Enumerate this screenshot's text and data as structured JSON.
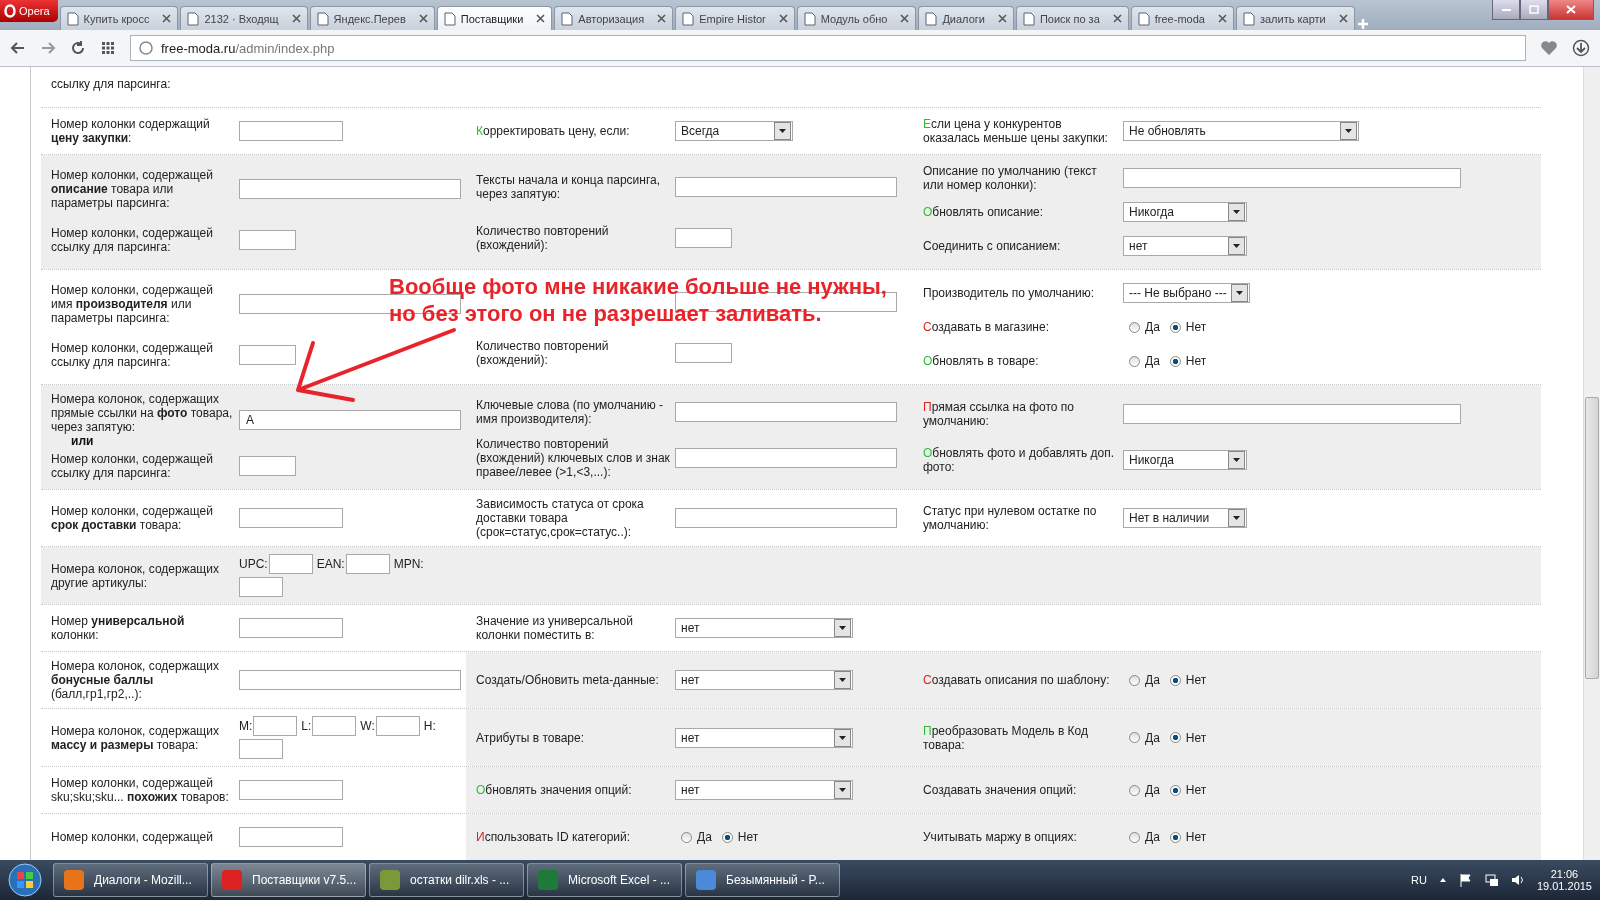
{
  "browser": {
    "menu_button": "Opera",
    "tabs": [
      {
        "label": "Купить кросс",
        "selected": false
      },
      {
        "label": "2132 · Входящ",
        "selected": false
      },
      {
        "label": "Яндекс.Перев",
        "selected": false
      },
      {
        "label": "Поставщики",
        "selected": true
      },
      {
        "label": "Авторизация",
        "selected": false
      },
      {
        "label": "Empire Histor",
        "selected": false
      },
      {
        "label": "Модуль обно",
        "selected": false
      },
      {
        "label": "Диалоги",
        "selected": false
      },
      {
        "label": "Поиск по за",
        "selected": false
      },
      {
        "label": "free-moda",
        "selected": false
      },
      {
        "label": "залить карти",
        "selected": false
      }
    ],
    "address": {
      "host": "free-moda.ru",
      "path": "/admin/index.php"
    }
  },
  "sections": [
    {
      "left_shaded": false,
      "right_shaded": false,
      "left": [
        {
          "label": "ссылку для парсинга:"
        }
      ]
    },
    {
      "left_shaded": false,
      "right_shaded": false,
      "left": [
        {
          "label": "Номер колонки содержащий **цену закупки**:",
          "control": {
            "kind": "input_medium"
          }
        }
      ],
      "middle": [
        {
          "label": "Корректировать цену, если:",
          "color": "#33bb33",
          "control": {
            "kind": "select_small",
            "value": "Всегда"
          }
        }
      ],
      "right": [
        {
          "label": "Если цена у конкурентов оказалась меньше цены закупки:",
          "color": "#33bb33",
          "control": {
            "kind": "select_xlarge",
            "value": "Не обновлять"
          }
        }
      ]
    },
    {
      "left_shaded": true,
      "right_shaded": true,
      "left": [
        {
          "label": "Номер колонки, содержащей **описание** товара или параметры парсинга:",
          "control": {
            "kind": "input_wide"
          }
        },
        {
          "label": "Номер колонки, содержащей ссылку для парсинга:",
          "control": {
            "kind": "input_small"
          }
        }
      ],
      "middle": [
        {
          "label": "Тексты начала и конца парсинга, через запятую:",
          "control": {
            "kind": "input_wide"
          }
        },
        {
          "label": "Количество повторений (вхождений):",
          "control": {
            "kind": "input_small"
          }
        }
      ],
      "right": [
        {
          "label": "Описание по умолчанию (текст или номер колонки):",
          "control": {
            "kind": "input_xwide"
          }
        },
        {
          "label": "Обновлять описание:",
          "color": "#33bb33",
          "control": {
            "kind": "select_medium",
            "value": "Никогда"
          }
        },
        {
          "label": "Соединить с описанием:",
          "control": {
            "kind": "select_medium",
            "value": "нет"
          }
        }
      ]
    },
    {
      "left_shaded": false,
      "right_shaded": false,
      "left": [
        {
          "label": "Номер колонки, содержащей имя **производителя** или параметры парсинга:",
          "control": {
            "kind": "input_wide"
          }
        },
        {
          "label": "Номер колонки, содержащей ссылку для парсинга:",
          "control": {
            "kind": "input_small"
          }
        }
      ],
      "middle": [
        {
          "control": {
            "kind": "input_wide"
          }
        },
        {
          "label": "Количество повторений (вхождений):",
          "control": {
            "kind": "input_small"
          }
        }
      ],
      "annotation": {
        "lines": [
          "Вообще фото мне никакие больше не нужны,",
          "но без этого он не разрешает заливать."
        ]
      },
      "right": [
        {
          "label": "Производитель по умолчанию:",
          "control": {
            "kind": "select_medium",
            "value": "--- Не выбрано ---"
          }
        },
        {
          "label": "Создавать в магазине:",
          "color": "#dd2222",
          "control": {
            "kind": "radio",
            "options": [
              {
                "label": "Да",
                "selected": false
              },
              {
                "label": "Нет",
                "selected": true
              }
            ]
          }
        },
        {
          "label": "Обновлять в товаре:",
          "color": "#33bb33",
          "control": {
            "kind": "radio",
            "options": [
              {
                "label": "Да",
                "selected": false
              },
              {
                "label": "Нет",
                "selected": true
              }
            ]
          }
        }
      ]
    },
    {
      "left_shaded": true,
      "right_shaded": true,
      "left": [
        {
          "label": "Номера колонок, содержащих прямые ссылки на **фото** товара, через запятую:",
          "note": "или",
          "control": {
            "kind": "input_wide",
            "value": "A"
          }
        },
        {
          "label": "Номер колонки, содержащей ссылку для парсинга:",
          "control": {
            "kind": "input_small"
          }
        }
      ],
      "middle": [
        {
          "label": "Ключевые слова (по умолчанию - имя производителя):",
          "control": {
            "kind": "input_wide"
          }
        },
        {
          "label": "Количество повторений (вхождений) ключевых слов и знак правее/левее (>1,<3,...):",
          "control": {
            "kind": "input_wide"
          }
        }
      ],
      "right": [
        {
          "label": "Прямая ссылка на фото по умолчанию:",
          "color": "#dd2222",
          "control": {
            "kind": "input_xwide"
          }
        },
        {
          "label": "Обновлять фото и добавлять доп. фото:",
          "color": "#33bb33",
          "control": {
            "kind": "select_medium",
            "value": "Никогда"
          }
        }
      ]
    },
    {
      "left_shaded": false,
      "right_shaded": false,
      "left": [
        {
          "label": "Номер колонки, содержащей **срок доставки** товара:",
          "control": {
            "kind": "input_medium"
          }
        }
      ],
      "middle": [
        {
          "label": "Зависимость статуса от срока доставки товара (срок=статус,срок=статус..):",
          "control": {
            "kind": "input_wide"
          }
        }
      ],
      "right": [
        {
          "label": "Статус при нулевом остатке по умолчанию:",
          "control": {
            "kind": "select_medium",
            "value": "Нет в наличии"
          }
        }
      ]
    },
    {
      "left_shaded": true,
      "right_shaded": true,
      "left": [
        {
          "label": "Номера колонок, содержащих другие артикулы:",
          "control": {
            "kind": "codes",
            "fields": [
              {
                "label": "UPC:"
              },
              {
                "label": "EAN:"
              },
              {
                "label": "MPN:"
              }
            ]
          }
        }
      ]
    },
    {
      "left_shaded": false,
      "right_shaded": false,
      "left": [
        {
          "label": "Номер **универсальной** колонки:",
          "control": {
            "kind": "input_medium"
          }
        }
      ],
      "middle": [
        {
          "label": "Значение из универсальной колонки поместить в:",
          "control": {
            "kind": "select_large",
            "value": "нет"
          }
        }
      ]
    },
    {
      "left_shaded": false,
      "right_shaded": true,
      "left": [
        {
          "label": "Номера колонок, содержащих **бонусные баллы** (балл,гр1,гр2,..):",
          "control": {
            "kind": "input_wide"
          }
        }
      ],
      "middle": [
        {
          "label": "Создать/Обновить meta-данные:",
          "control": {
            "kind": "select_large",
            "value": "нет"
          }
        }
      ],
      "right": [
        {
          "label": "Создавать описания по шаблону:",
          "color": "#dd2222",
          "control": {
            "kind": "radio",
            "options": [
              {
                "label": "Да",
                "selected": false
              },
              {
                "label": "Нет",
                "selected": true
              }
            ]
          }
        }
      ]
    },
    {
      "left_shaded": false,
      "right_shaded": true,
      "left": [
        {
          "label": "Номера колонок, содержащих **массу и размеры** товара:",
          "control": {
            "kind": "codes",
            "fields": [
              {
                "label": "M:"
              },
              {
                "label": "L:"
              },
              {
                "label": "W:"
              },
              {
                "label": "H:"
              }
            ]
          }
        }
      ],
      "middle": [
        {
          "label": "Атрибуты в товаре:",
          "control": {
            "kind": "select_large",
            "value": "нет"
          }
        }
      ],
      "right": [
        {
          "label": "Преобразовать Модель в Код товара:",
          "color": "#33bb33",
          "control": {
            "kind": "radio",
            "options": [
              {
                "label": "Да",
                "selected": false
              },
              {
                "label": "Нет",
                "selected": true
              }
            ]
          }
        }
      ]
    },
    {
      "left_shaded": false,
      "right_shaded": true,
      "left": [
        {
          "label": "Номер колонки, содержащей sku;sku;sku... **похожих** товаров:",
          "control": {
            "kind": "input_medium"
          }
        }
      ],
      "middle": [
        {
          "label": "Обновлять значения опций:",
          "color": "#33bb33",
          "control": {
            "kind": "select_large",
            "value": "нет"
          }
        }
      ],
      "right": [
        {
          "label": "Создавать значения опций:",
          "control": {
            "kind": "radio",
            "options": [
              {
                "label": "Да",
                "selected": false
              },
              {
                "label": "Нет",
                "selected": true
              }
            ]
          }
        }
      ]
    },
    {
      "left_shaded": false,
      "right_shaded": true,
      "left": [
        {
          "label": "Номер колонки, содержащей",
          "control": {
            "kind": "input_medium"
          }
        }
      ],
      "middle": [
        {
          "label": "Использовать ID категорий:",
          "color": "#dd2222",
          "control": {
            "kind": "radio",
            "options": [
              {
                "label": "Да",
                "selected": false
              },
              {
                "label": "Нет",
                "selected": true
              }
            ]
          }
        }
      ],
      "right": [
        {
          "label": "Учитывать маржу в опциях:",
          "control": {
            "kind": "radio",
            "options": [
              {
                "label": "Да",
                "selected": false
              },
              {
                "label": "Нет",
                "selected": true
              }
            ]
          }
        }
      ]
    }
  ],
  "taskbar": {
    "items": [
      {
        "label": "Диалоги - Mozill...",
        "selected": false
      },
      {
        "label": "Поставщики v7.5...",
        "selected": true
      },
      {
        "label": "остатки dilr.xls - ...",
        "selected": false
      },
      {
        "label": "Microsoft Excel - ...",
        "selected": false
      },
      {
        "label": "Безымянный - P...",
        "selected": false
      }
    ],
    "language": "RU",
    "time": "21:06",
    "date": "19.01.2015"
  }
}
